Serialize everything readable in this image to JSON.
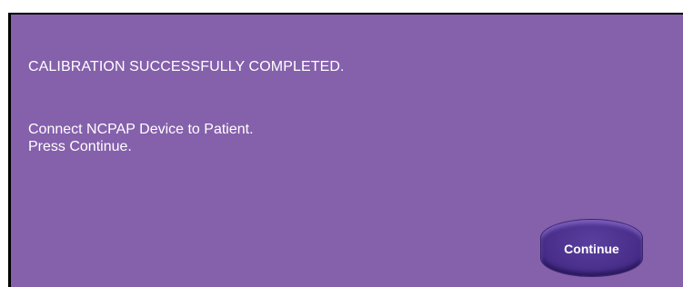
{
  "dialog": {
    "heading": "CALIBRATION SUCCESSFULLY COMPLETED.",
    "instruction_line_1": "Connect NCPAP Device to Patient.",
    "instruction_line_2": "Press Continue.",
    "continue_label": "Continue"
  },
  "colors": {
    "background": "#8560ab",
    "button": "#4a2f8c",
    "text": "#ffffff"
  }
}
